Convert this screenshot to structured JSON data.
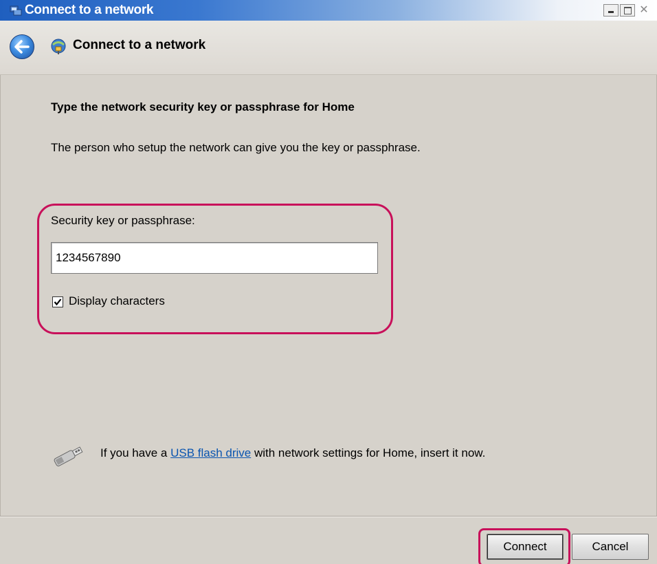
{
  "window": {
    "title": "Connect to a network"
  },
  "nav": {
    "title": "Connect to a network",
    "back_icon": "back-arrow-icon",
    "network_icon": "network-icon"
  },
  "content": {
    "heading": "Type the network security key or passphrase for Home",
    "description": "The person who setup the network can give you the key or passphrase.",
    "key_label": "Security key or passphrase:",
    "key_value": "1234567890",
    "display_characters": {
      "label": "Display characters",
      "checked": true
    },
    "usb": {
      "icon": "usb-drive-icon",
      "prefix": "If you have a ",
      "link": "USB flash drive",
      "suffix": " with network settings for Home, insert it now."
    }
  },
  "buttons": {
    "connect": "Connect",
    "cancel": "Cancel"
  },
  "colors": {
    "highlight": "#c8105a",
    "link": "#0a55b0",
    "title_bar": "#1f5fbf"
  }
}
